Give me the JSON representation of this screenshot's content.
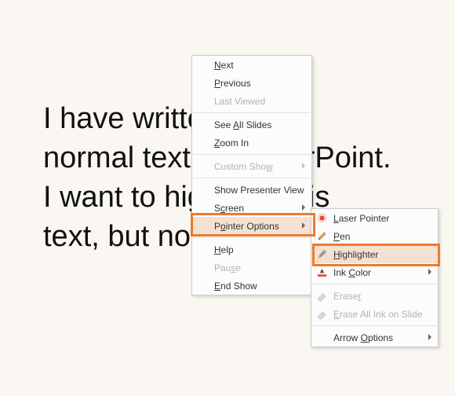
{
  "slide": {
    "line1": "I have written some",
    "line2": "normal text in PowerPoint.",
    "line3": "I want to highlight this",
    "line4": "text, but not all."
  },
  "menu1": {
    "next": "Next",
    "previous": "Previous",
    "last_viewed": "Last Viewed",
    "see_all_slides": "See All Slides",
    "zoom_in": "Zoom In",
    "custom_show": "Custom Show",
    "show_presenter_view": "Show Presenter View",
    "screen": "Screen",
    "pointer_options": "Pointer Options",
    "help": "Help",
    "pause": "Pause",
    "end_show": "End Show"
  },
  "menu2": {
    "laser_pointer": "Laser Pointer",
    "pen": "Pen",
    "highlighter": "Highlighter",
    "ink_color": "Ink Color",
    "eraser": "Eraser",
    "erase_all": "Erase All Ink on Slide",
    "arrow_options": "Arrow Options"
  }
}
